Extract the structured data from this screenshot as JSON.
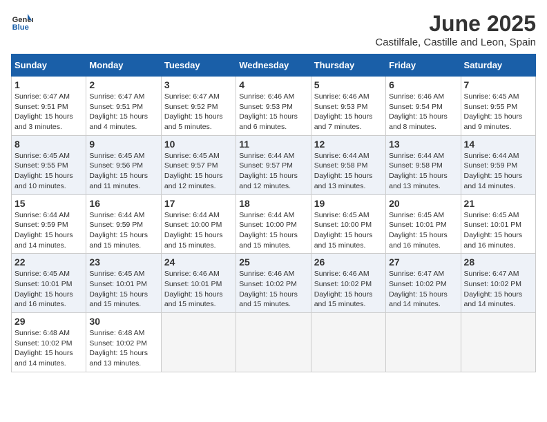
{
  "logo": {
    "general": "General",
    "blue": "Blue"
  },
  "title": "June 2025",
  "subtitle": "Castilfale, Castille and Leon, Spain",
  "weekdays": [
    "Sunday",
    "Monday",
    "Tuesday",
    "Wednesday",
    "Thursday",
    "Friday",
    "Saturday"
  ],
  "weeks": [
    [
      {
        "day": "1",
        "sunrise": "6:47 AM",
        "sunset": "9:51 PM",
        "daylight": "15 hours and 3 minutes."
      },
      {
        "day": "2",
        "sunrise": "6:47 AM",
        "sunset": "9:51 PM",
        "daylight": "15 hours and 4 minutes."
      },
      {
        "day": "3",
        "sunrise": "6:47 AM",
        "sunset": "9:52 PM",
        "daylight": "15 hours and 5 minutes."
      },
      {
        "day": "4",
        "sunrise": "6:46 AM",
        "sunset": "9:53 PM",
        "daylight": "15 hours and 6 minutes."
      },
      {
        "day": "5",
        "sunrise": "6:46 AM",
        "sunset": "9:53 PM",
        "daylight": "15 hours and 7 minutes."
      },
      {
        "day": "6",
        "sunrise": "6:46 AM",
        "sunset": "9:54 PM",
        "daylight": "15 hours and 8 minutes."
      },
      {
        "day": "7",
        "sunrise": "6:45 AM",
        "sunset": "9:55 PM",
        "daylight": "15 hours and 9 minutes."
      }
    ],
    [
      {
        "day": "8",
        "sunrise": "6:45 AM",
        "sunset": "9:55 PM",
        "daylight": "15 hours and 10 minutes."
      },
      {
        "day": "9",
        "sunrise": "6:45 AM",
        "sunset": "9:56 PM",
        "daylight": "15 hours and 11 minutes."
      },
      {
        "day": "10",
        "sunrise": "6:45 AM",
        "sunset": "9:57 PM",
        "daylight": "15 hours and 12 minutes."
      },
      {
        "day": "11",
        "sunrise": "6:44 AM",
        "sunset": "9:57 PM",
        "daylight": "15 hours and 12 minutes."
      },
      {
        "day": "12",
        "sunrise": "6:44 AM",
        "sunset": "9:58 PM",
        "daylight": "15 hours and 13 minutes."
      },
      {
        "day": "13",
        "sunrise": "6:44 AM",
        "sunset": "9:58 PM",
        "daylight": "15 hours and 13 minutes."
      },
      {
        "day": "14",
        "sunrise": "6:44 AM",
        "sunset": "9:59 PM",
        "daylight": "15 hours and 14 minutes."
      }
    ],
    [
      {
        "day": "15",
        "sunrise": "6:44 AM",
        "sunset": "9:59 PM",
        "daylight": "15 hours and 14 minutes."
      },
      {
        "day": "16",
        "sunrise": "6:44 AM",
        "sunset": "9:59 PM",
        "daylight": "15 hours and 15 minutes."
      },
      {
        "day": "17",
        "sunrise": "6:44 AM",
        "sunset": "10:00 PM",
        "daylight": "15 hours and 15 minutes."
      },
      {
        "day": "18",
        "sunrise": "6:44 AM",
        "sunset": "10:00 PM",
        "daylight": "15 hours and 15 minutes."
      },
      {
        "day": "19",
        "sunrise": "6:45 AM",
        "sunset": "10:00 PM",
        "daylight": "15 hours and 15 minutes."
      },
      {
        "day": "20",
        "sunrise": "6:45 AM",
        "sunset": "10:01 PM",
        "daylight": "15 hours and 16 minutes."
      },
      {
        "day": "21",
        "sunrise": "6:45 AM",
        "sunset": "10:01 PM",
        "daylight": "15 hours and 16 minutes."
      }
    ],
    [
      {
        "day": "22",
        "sunrise": "6:45 AM",
        "sunset": "10:01 PM",
        "daylight": "15 hours and 16 minutes."
      },
      {
        "day": "23",
        "sunrise": "6:45 AM",
        "sunset": "10:01 PM",
        "daylight": "15 hours and 15 minutes."
      },
      {
        "day": "24",
        "sunrise": "6:46 AM",
        "sunset": "10:01 PM",
        "daylight": "15 hours and 15 minutes."
      },
      {
        "day": "25",
        "sunrise": "6:46 AM",
        "sunset": "10:02 PM",
        "daylight": "15 hours and 15 minutes."
      },
      {
        "day": "26",
        "sunrise": "6:46 AM",
        "sunset": "10:02 PM",
        "daylight": "15 hours and 15 minutes."
      },
      {
        "day": "27",
        "sunrise": "6:47 AM",
        "sunset": "10:02 PM",
        "daylight": "15 hours and 14 minutes."
      },
      {
        "day": "28",
        "sunrise": "6:47 AM",
        "sunset": "10:02 PM",
        "daylight": "15 hours and 14 minutes."
      }
    ],
    [
      {
        "day": "29",
        "sunrise": "6:48 AM",
        "sunset": "10:02 PM",
        "daylight": "15 hours and 14 minutes."
      },
      {
        "day": "30",
        "sunrise": "6:48 AM",
        "sunset": "10:02 PM",
        "daylight": "15 hours and 13 minutes."
      },
      null,
      null,
      null,
      null,
      null
    ]
  ]
}
